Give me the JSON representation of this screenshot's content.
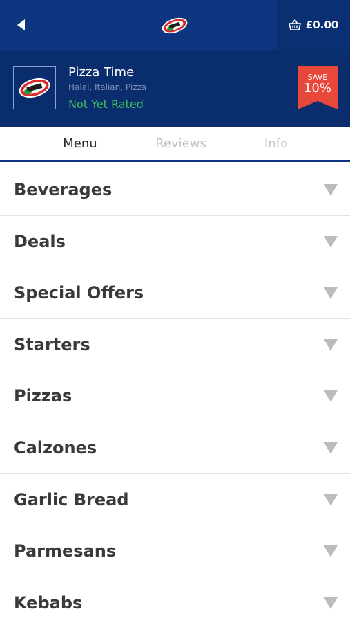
{
  "header": {
    "cart_total": "£0.00",
    "back_icon": "back-arrow-icon",
    "cart_icon": "basket-icon",
    "bg_color": "#0d3580"
  },
  "restaurant": {
    "name": "Pizza Time",
    "cuisine": "Halal, Italian, Pizza",
    "rating": "Not Yet Rated",
    "save_label": "SAVE",
    "save_percent": "10%",
    "rating_color": "#3fc05a",
    "badge_color": "#e8483a"
  },
  "tabs": [
    {
      "label": "Menu",
      "active": true
    },
    {
      "label": "Reviews",
      "active": false
    },
    {
      "label": "Info",
      "active": false
    }
  ],
  "categories": [
    {
      "label": "Beverages"
    },
    {
      "label": "Deals"
    },
    {
      "label": "Special Offers"
    },
    {
      "label": "Starters"
    },
    {
      "label": "Pizzas"
    },
    {
      "label": "Calzones"
    },
    {
      "label": "Garlic Bread"
    },
    {
      "label": "Parmesans"
    },
    {
      "label": "Kebabs"
    }
  ]
}
